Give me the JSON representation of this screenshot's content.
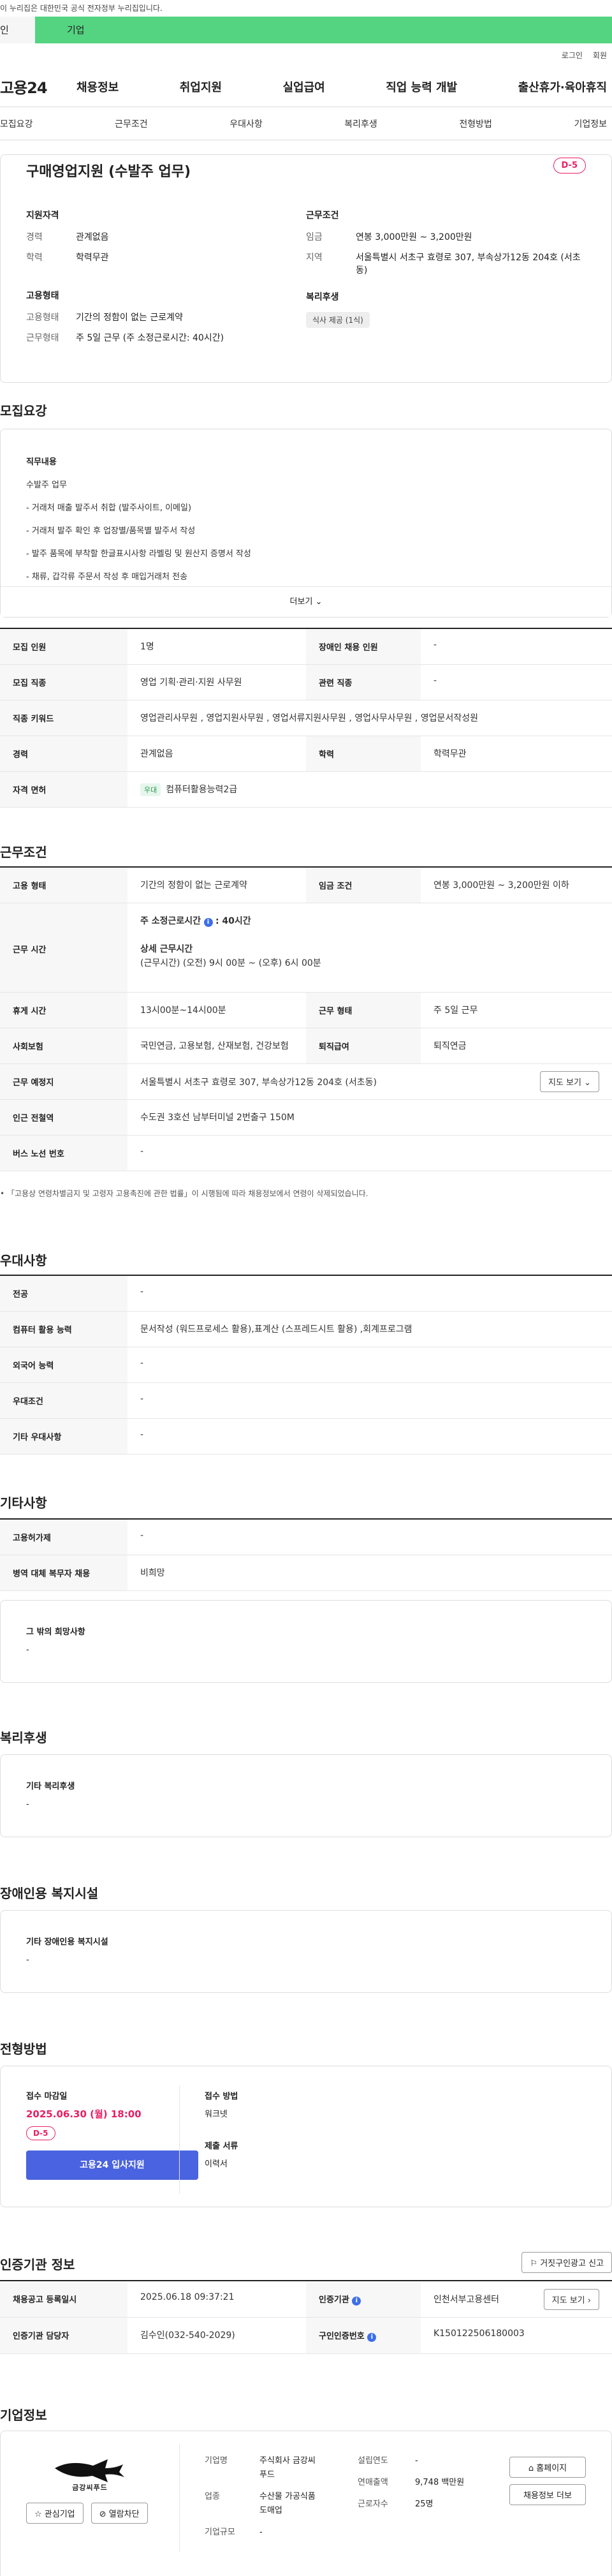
{
  "notice": "이 누리집은 대한민국 공식 전자정부 누리집입니다.",
  "typebar": {
    "tab1": "인",
    "tab2": "기업"
  },
  "top_links": {
    "login": "로그인",
    "join": "회원"
  },
  "logo": "고용24",
  "gnb": [
    "채용정보",
    "취업지원",
    "실업급여",
    "직업 능력 개발",
    "출산휴가·육아휴직"
  ],
  "subnav": [
    "모집요강",
    "근무조건",
    "우대사항",
    "복리후생",
    "전형방법",
    "기업정보"
  ],
  "summary": {
    "title": "구매영업지원 (수발주 업무)",
    "dday": "D-5",
    "qual_h": "지원자격",
    "career_k": "경력",
    "career_v": "관계없음",
    "edu_k": "학력",
    "edu_v": "학력무관",
    "emp_h": "고용형태",
    "emptype_k": "고용형태",
    "emptype_v": "기간의 정함이 없는 근로계약",
    "worktime_k": "근무형태",
    "worktime_v": "주 5일 근무 (주 소정근로시간: 40시간)",
    "cond_h": "근무조건",
    "wage_k": "임금",
    "wage_v": "연봉 3,000만원 ~ 3,200만원",
    "area_k": "지역",
    "area_v": "서울특별시 서초구 효령로 307, 부속상가12동 204호 (서초동)",
    "welfare_h": "복리후생",
    "welfare_tag": "식사 제공 (1식)"
  },
  "recruit": {
    "heading": "모집요강",
    "duty_h": "직무내용",
    "duty_lines": [
      "수발주 업무",
      "- 거래처 매출 발주서 취합 (발주사이트, 이메일)",
      "- 거래처 발주 확인 후 업장별/품목별 발주서 작성",
      "- 발주 품목에 부착할 한글표시사항 라벨링 및 원산지 증명서 작성",
      "- 채류, 갑각류 주문서 작성 후 매입거래처 전송"
    ],
    "more": "더보기",
    "rows": [
      {
        "k1": "모집 인원",
        "v1": "1명",
        "k2": "장애인 채용 인원",
        "v2": "-"
      },
      {
        "k1": "모집 직종",
        "v1": "영업 기획·관리·지원 사무원",
        "k2": "관련 직종",
        "v2": "-"
      }
    ],
    "keyword_k": "직종 키워드",
    "keyword_v": "영업관리사무원 , 영업지원사무원 , 영업서류지원사무원 , 영업사무사무원 , 영업문서작성원",
    "career_k": "경력",
    "career_v": "관계없음",
    "edu_k": "학력",
    "edu_v": "학력무관",
    "license_k": "자격 면허",
    "license_tag": "우대",
    "license_v": "컴퓨터활용능력2급"
  },
  "conditions": {
    "heading": "근무조건",
    "emp_k": "고용 형태",
    "emp_v": "기간의 정함이 없는 근로계약",
    "wage_k": "임금 조건",
    "wage_v": "연봉 3,000만원 ~ 3,200만원 이하",
    "time_k": "근무 시간",
    "time_v1_label": "주 소정근로시간",
    "time_v1": ": 40시간",
    "time_v2_label": "상세 근무시간",
    "time_v2": "(근무시간) (오전) 9시 00분 ~ (오후) 6시 00분",
    "rest_k": "휴게 시간",
    "rest_v": "13시00분~14시00분",
    "type_k": "근무 형태",
    "type_v": "주 5일 근무",
    "ins_k": "사회보험",
    "ins_v": "국민연금, 고용보험, 산재보험, 건강보험",
    "ret_k": "퇴직급여",
    "ret_v": "퇴직연금",
    "place_k": "근무 예정지",
    "place_v": "서울특별시 서초구 효령로 307, 부속상가12동 204호 (서초동)",
    "map_btn": "지도 보기",
    "subway_k": "인근 전철역",
    "subway_v": "수도권 3호선 남부터미널 2번출구 150M",
    "bus_k": "버스 노선 번호",
    "bus_v": "-",
    "footnote": "「고용상 연령차별금지 및 고령자 고용촉진에 관한 법률」이 시행됨에 따라 채용정보에서 연령이 삭제되었습니다."
  },
  "prefer": {
    "heading": "우대사항",
    "rows": [
      {
        "k": "전공",
        "v": "-"
      },
      {
        "k": "컴퓨터 활용 능력",
        "v": "문서작성 (워드프로세스 활용),표계산 (스프레드시트 활용) ,회계프로그램"
      },
      {
        "k": "외국어 능력",
        "v": "-"
      },
      {
        "k": "우대조건",
        "v": "-"
      },
      {
        "k": "기타 우대사항",
        "v": "-"
      }
    ]
  },
  "etc": {
    "heading": "기타사항",
    "rows": [
      {
        "k": "고용허가제",
        "v": "-"
      },
      {
        "k": "병역 대체 복무자 채용",
        "v": "비희망"
      }
    ],
    "hope_h": "그 밖의 희망사항",
    "hope_v": "-"
  },
  "welfare": {
    "heading": "복리후생",
    "card_h": "기타 복리후생",
    "card_v": "-"
  },
  "disabled": {
    "heading": "장애인용 복지시설",
    "card_h": "기타 장애인용 복지시설",
    "card_v": "-"
  },
  "selection": {
    "heading": "전형방법",
    "deadline_h": "접수 마감일",
    "deadline_v": "2025.06.30 (월) 18:00",
    "dday": "D-5",
    "apply_btn": "고용24 입사지원",
    "method_h": "접수 방법",
    "method_v": "워크넷",
    "docs_h": "제출 서류",
    "docs_v": "이력서"
  },
  "certify": {
    "heading": "인증기관 정보",
    "report_btn": "거짓구인광고 신고",
    "date_k": "채용공고 등록일시",
    "date_v": "2025.06.18 09:37:21",
    "org_k": "인증기관",
    "org_v": "인천서부고용센터",
    "map_btn": "지도 보기",
    "person_k": "인증기관 담당자",
    "person_v": "김수인(032-540-2029)",
    "num_k": "구인인증번호",
    "num_v": "K150122506180003"
  },
  "company": {
    "heading": "기업정보",
    "logo_text": "금강씨푸드",
    "interest_btn": "관심기업",
    "block_btn": "열람차단",
    "name_k": "기업명",
    "name_v1": "주식회사 금강씨",
    "name_v2": "푸드",
    "biz_k": "업종",
    "biz_v1": "수산물 가공식품",
    "biz_v2": "도매업",
    "size_k": "기업규모",
    "size_v": "-",
    "est_k": "설립연도",
    "est_v": "-",
    "sales_k": "연매출액",
    "sales_v": "9,748 백만원",
    "emp_k": "근로자수",
    "emp_v": "25명",
    "home_btn": "홈페이지",
    "jobs_btn": "채용정보 더보"
  }
}
